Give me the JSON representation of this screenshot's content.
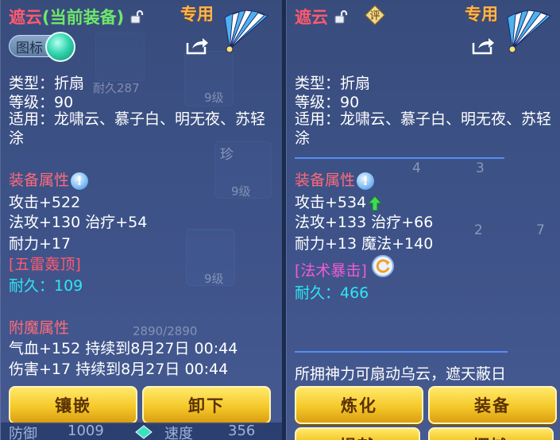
{
  "left": {
    "title": "遮云",
    "title_sub": "(当前装备)",
    "special": "专用",
    "badge_label": "图标",
    "type": "类型：折扇",
    "level": "等级：90",
    "applicable": "适用：龙啸云、慕子白、明无夜、苏轻涂",
    "section_equip": "装备属性",
    "attack": "攻击+522",
    "magic_heal": "法攻+130 治疗+54",
    "stamina": "耐力+17",
    "skill": "[五雷轰顶]",
    "durability": "耐久：109",
    "section_enchant": "附魔属性",
    "enchant_hp": "气血+152 持续到8月27日 00:44",
    "enchant_dmg": "伤害+17 持续到8月27日 00:44",
    "btn_inlay": "镶嵌",
    "btn_unequip": "卸下",
    "bottom_defense_label": "防御",
    "bottom_defense_value": "1009",
    "bottom_speed_label": "速度",
    "bottom_speed_value": "356"
  },
  "right": {
    "title": "遮云",
    "rate_icon_char": "评",
    "special": "专用",
    "type": "类型：折扇",
    "level": "等级：90",
    "applicable": "适用：龙啸云、慕子白、明无夜、苏轻涂",
    "section_equip": "装备属性",
    "attack": "攻击+534",
    "magic_heal": "法攻+133 治疗+66",
    "stamina_mana": "耐力+13 魔法+140",
    "skill": "[法术暴击]",
    "durability": "耐久：466",
    "description": "所拥神力可扇动乌云，遮天蔽日",
    "btn_refine": "炼化",
    "btn_equip": "装备",
    "btn_c": "捐献",
    "btn_d": "摆摊"
  },
  "bg": {
    "durability_hint": "耐久287",
    "level_tag_1": "9级",
    "level_tag_2": "9级",
    "level_tag_3": "9级",
    "rare_tag": "珍",
    "progress_text": "2890/2890",
    "count_4": "4",
    "count_3": "3",
    "count_2": "2",
    "count_7": "7"
  },
  "colors": {
    "title": "#ff5a6e",
    "current": "#6ee86a",
    "special": "#ffb64a",
    "durability": "#2ee6f2",
    "skill_pink": "#f05bd5",
    "button_gold": "#f6c92a"
  }
}
